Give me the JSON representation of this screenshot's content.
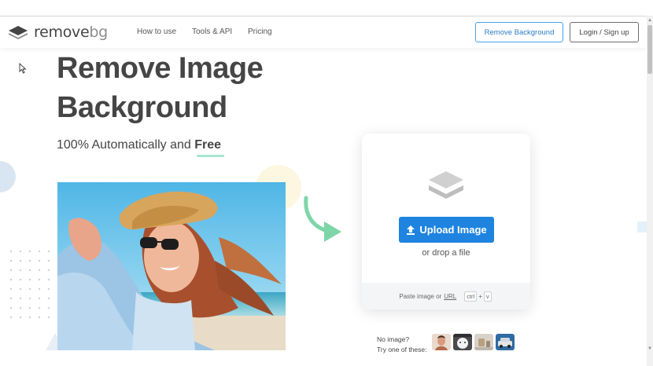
{
  "header": {
    "logo_text": "remove",
    "logo_suffix": "bg",
    "nav": [
      "How to use",
      "Tools & API",
      "Pricing"
    ],
    "remove_bg_button": "Remove Background",
    "login_button": "Login / Sign up"
  },
  "hero": {
    "title_line1": "Remove Image",
    "title_line2": "Background",
    "subtitle_prefix": "100% Automatically and ",
    "subtitle_highlight": "Free"
  },
  "upload": {
    "button_label": "Upload Image",
    "drop_text": "or drop a file",
    "paste_prefix": "Paste image or",
    "paste_url": "URL",
    "key_ctrl": "ctrl",
    "key_plus": "+",
    "key_v": "v"
  },
  "samples": {
    "line1": "No image?",
    "line2": "Try one of these:"
  },
  "colors": {
    "accent_blue": "#1e84e0",
    "text_dark": "#454545",
    "highlight_green": "#a8e6cf",
    "arrow_green": "#7ed6a8"
  },
  "icons": {
    "logo": "layers-icon",
    "upload": "upload-arrow-icon",
    "card": "layers-icon",
    "arrow": "curved-arrow-icon",
    "cursor": "mouse-pointer-icon"
  }
}
